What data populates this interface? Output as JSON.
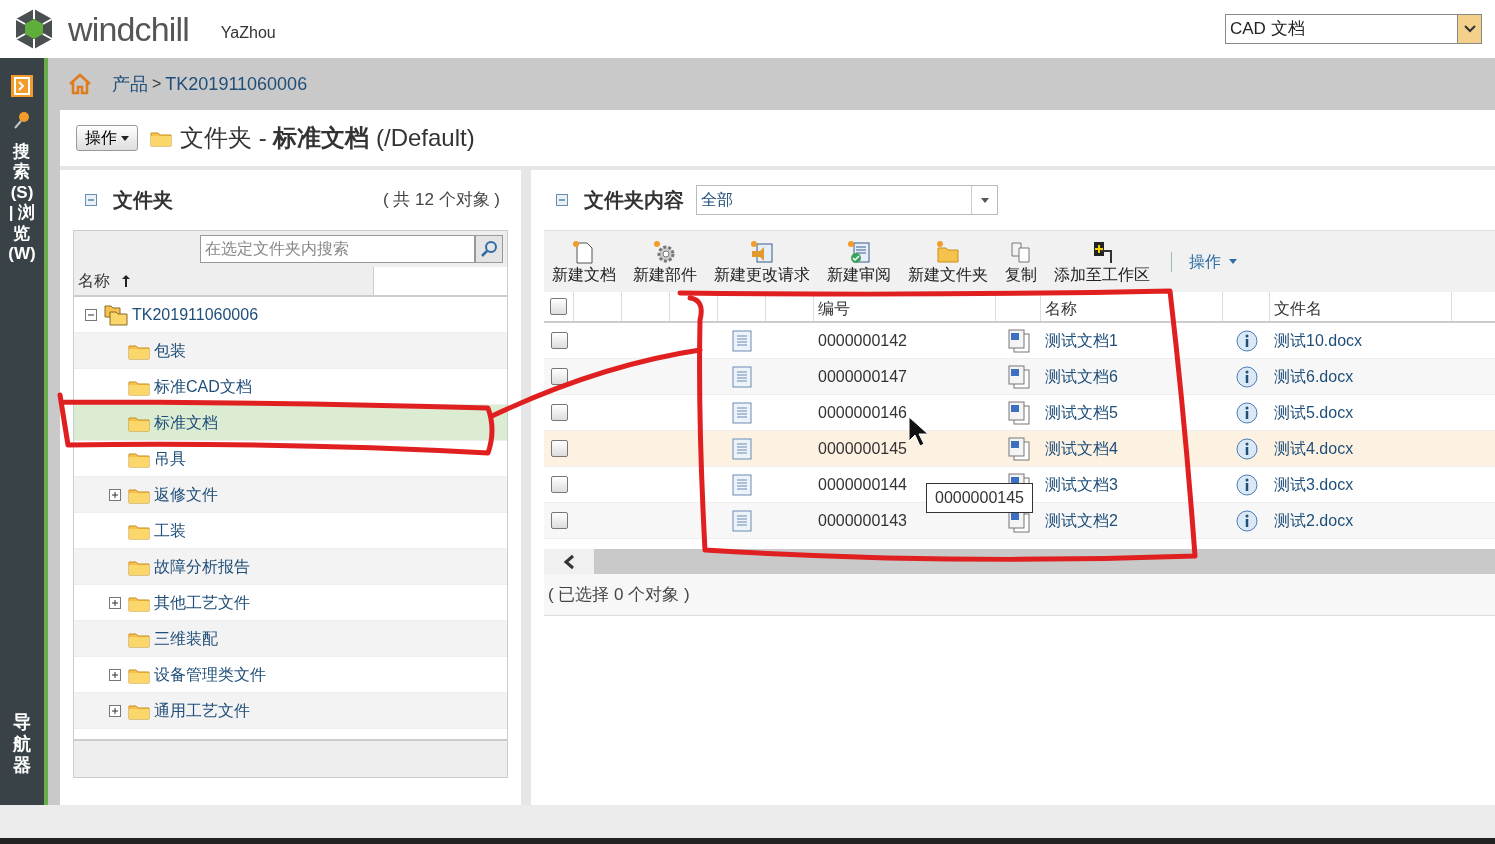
{
  "header": {
    "logo_text": "windchill",
    "user": "YaZhou",
    "type_select": "CAD 文档"
  },
  "side_rail": {
    "tabs": [
      {
        "label": "搜索(S) | 浏览(W)"
      },
      {
        "label": "导航器"
      }
    ]
  },
  "breadcrumb": {
    "items": [
      "产品",
      "TK201911060006"
    ],
    "separator": ">"
  },
  "page_title": {
    "actions_button": "操作",
    "title": "文件夹 - **标准文档** (/Default)"
  },
  "folder_panel": {
    "title": "文件夹",
    "count": "( 共 12 个对象 )",
    "search": {
      "placeholder": "在选定文件夹内搜索"
    },
    "column": "名称",
    "tree": [
      {
        "label": "TK201911060006",
        "expanded": true,
        "selected": false,
        "children": [
          {
            "label": "包装",
            "expandable": false,
            "selected": false
          },
          {
            "label": "标准CAD文档",
            "expandable": false,
            "selected": false
          },
          {
            "label": "标准文档",
            "expandable": false,
            "selected": true
          },
          {
            "label": "吊具",
            "expandable": false,
            "selected": false
          },
          {
            "label": "返修文件",
            "expandable": true,
            "selected": false
          },
          {
            "label": "工装",
            "expandable": false,
            "selected": false
          },
          {
            "label": "故障分析报告",
            "expandable": false,
            "selected": false
          },
          {
            "label": "其他工艺文件",
            "expandable": true,
            "selected": false
          },
          {
            "label": "三维装配",
            "expandable": false,
            "selected": false
          },
          {
            "label": "设备管理类文件",
            "expandable": true,
            "selected": false
          },
          {
            "label": "通用工艺文件",
            "expandable": true,
            "selected": false
          }
        ]
      }
    ]
  },
  "content_panel": {
    "title": "文件夹内容",
    "filter": "全部",
    "toolbar": [
      {
        "label": "新建文档",
        "kind": "doc"
      },
      {
        "label": "新建部件",
        "kind": "part"
      },
      {
        "label": "新建更改请求",
        "kind": "change"
      },
      {
        "label": "新建审阅",
        "kind": "review"
      },
      {
        "label": "新建文件夹",
        "kind": "folder"
      },
      {
        "label": "复制",
        "kind": "copy"
      },
      {
        "label": "添加至工作区",
        "kind": "workspace"
      }
    ],
    "actions_menu": "操作",
    "select_all_checked": false,
    "columns": [
      "编号",
      "名称",
      "文件名"
    ],
    "rows": [
      {
        "number": "0000000142",
        "name": "测试文档1",
        "file_name": "测试10.docx",
        "checked": false,
        "hovered": false
      },
      {
        "number": "0000000147",
        "name": "测试文档6",
        "file_name": "测试6.docx",
        "checked": false,
        "hovered": false
      },
      {
        "number": "0000000146",
        "name": "测试文档5",
        "file_name": "测试5.docx",
        "checked": false,
        "hovered": false
      },
      {
        "number": "0000000145",
        "name": "测试文档4",
        "file_name": "测试4.docx",
        "checked": false,
        "hovered": true
      },
      {
        "number": "0000000144",
        "name": "测试文档3",
        "file_name": "测试3.docx",
        "checked": false,
        "hovered": false
      },
      {
        "number": "0000000143",
        "name": "测试文档2",
        "file_name": "测试2.docx",
        "checked": false,
        "hovered": false
      }
    ],
    "tooltip": "0000000145",
    "status": "( 已选择 0 个对象 )"
  }
}
